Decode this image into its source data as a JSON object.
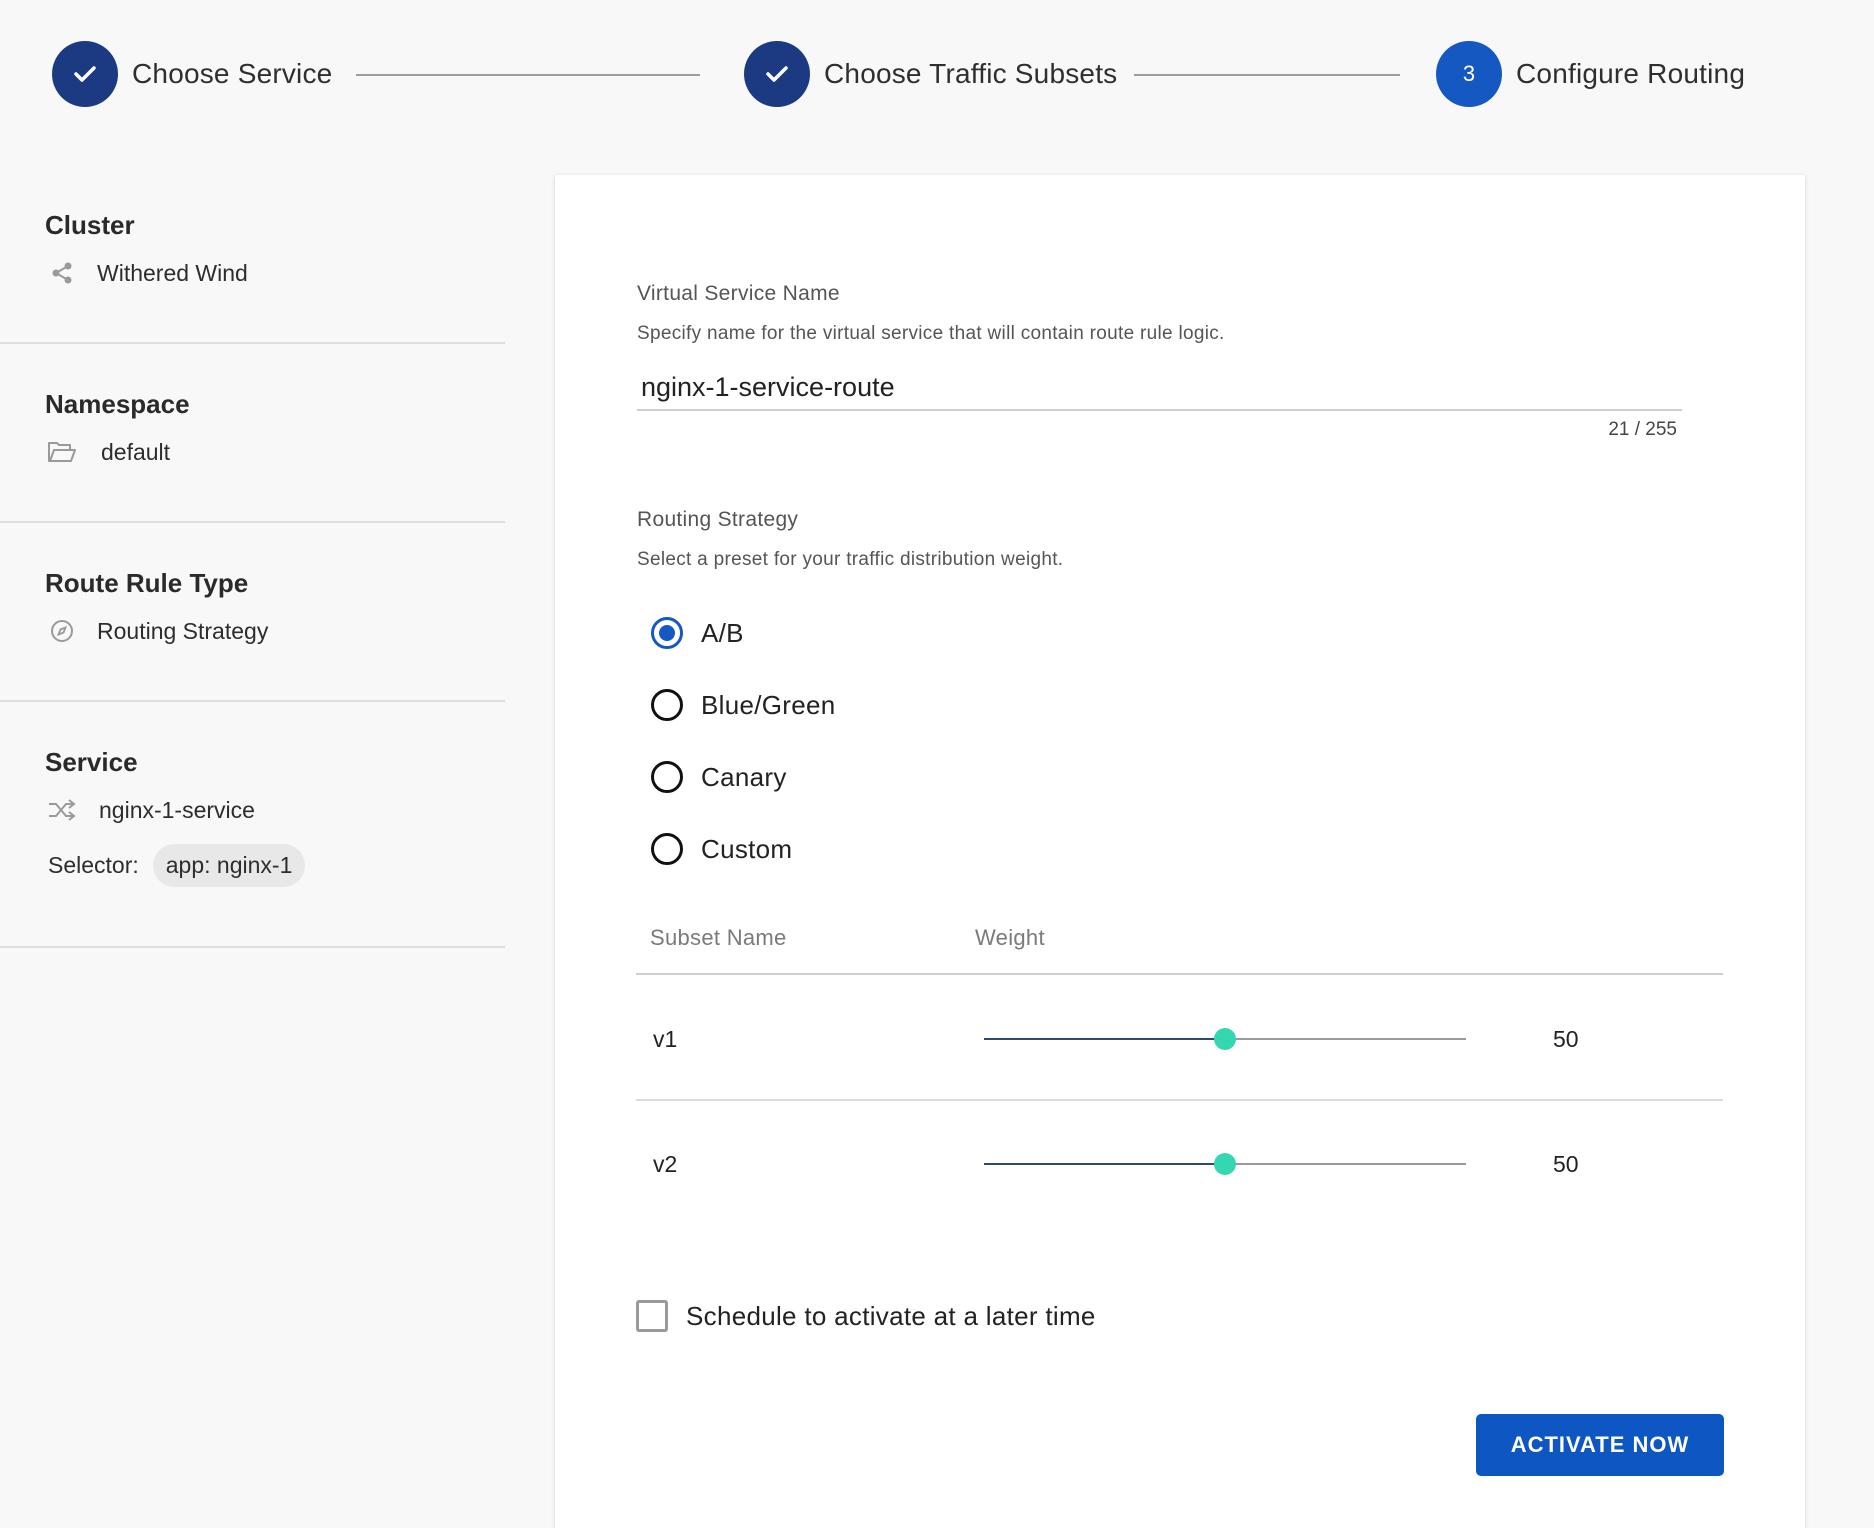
{
  "stepper": {
    "steps": [
      {
        "label": "Choose Service",
        "state": "done"
      },
      {
        "label": "Choose Traffic Subsets",
        "state": "done"
      },
      {
        "label": "Configure Routing",
        "state": "active",
        "number": "3"
      }
    ]
  },
  "sidebar": {
    "cluster": {
      "title": "Cluster",
      "value": "Withered Wind",
      "icon": "share-icon"
    },
    "namespace": {
      "title": "Namespace",
      "value": "default",
      "icon": "folder-open-icon"
    },
    "route_rule_type": {
      "title": "Route Rule Type",
      "value": "Routing Strategy",
      "icon": "compass-icon"
    },
    "service": {
      "title": "Service",
      "value": "nginx-1-service",
      "icon": "shuffle-icon",
      "selector_label": "Selector:",
      "selector_value": "app: nginx-1"
    }
  },
  "form": {
    "virtual_service": {
      "label": "Virtual Service Name",
      "help": "Specify name for the virtual service that will contain route rule logic.",
      "value": "nginx-1-service-route",
      "char_count": "21 / 255"
    },
    "routing_strategy": {
      "label": "Routing Strategy",
      "help": "Select a preset for your traffic distribution weight.",
      "options": [
        "A/B",
        "Blue/Green",
        "Canary",
        "Custom"
      ],
      "selected": "A/B"
    },
    "subsets_table": {
      "headers": {
        "name": "Subset Name",
        "weight": "Weight"
      },
      "rows": [
        {
          "name": "v1",
          "weight": "50",
          "weight_fraction": 0.5
        },
        {
          "name": "v2",
          "weight": "50",
          "weight_fraction": 0.5
        }
      ]
    },
    "schedule_label": "Schedule to activate at a later time",
    "activate_label": "ACTIVATE NOW"
  },
  "colors": {
    "step_done": "#1b3a82",
    "step_active": "#1658c2",
    "primary_button": "#0e56c2",
    "slider_thumb": "#35d6b2"
  }
}
